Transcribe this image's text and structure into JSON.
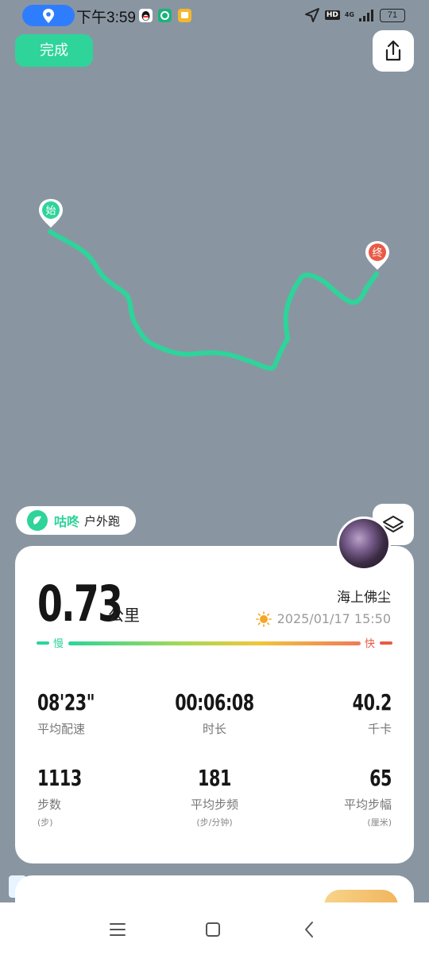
{
  "status_bar": {
    "time": "下午3:59",
    "hd": "HD",
    "network": "4G",
    "battery": "71"
  },
  "header": {
    "done_label": "完成"
  },
  "map": {
    "start_label": "始",
    "end_label": "终",
    "route_color": "#2ed49a"
  },
  "brand": {
    "name": "咕咚",
    "sport": "户外跑"
  },
  "summary": {
    "distance": "0.73",
    "distance_unit": "公里",
    "username": "海上佛尘",
    "datetime": "2025/01/17 15:50",
    "pace_slow_label": "慢",
    "pace_fast_label": "快"
  },
  "stats": [
    {
      "value": "08'23\"",
      "label": "平均配速",
      "unit": ""
    },
    {
      "value": "00:06:08",
      "label": "时长",
      "unit": ""
    },
    {
      "value": "40.2",
      "label": "千卡",
      "unit": ""
    },
    {
      "value": "1113",
      "label": "步数",
      "unit": "(步)"
    },
    {
      "value": "181",
      "label": "平均步频",
      "unit": "(步/分钟)"
    },
    {
      "value": "65",
      "label": "平均步幅",
      "unit": "(厘米)"
    }
  ],
  "colors": {
    "accent": "#2ed49a",
    "end_marker": "#ea5a46",
    "map_background": "#8996a2"
  }
}
